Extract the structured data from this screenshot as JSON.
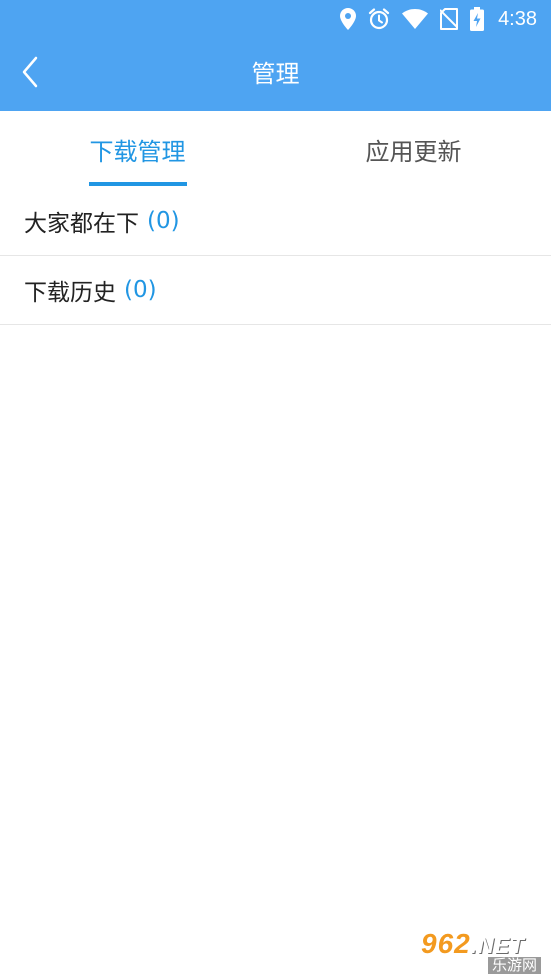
{
  "status_bar": {
    "time": "4:38",
    "icons": [
      "location-icon",
      "alarm-icon",
      "wifi-icon",
      "no-sim-icon",
      "battery-charging-icon"
    ]
  },
  "header": {
    "title": "管理",
    "back_icon": "chevron-left-icon"
  },
  "tabs": [
    {
      "label": "下载管理",
      "active": true
    },
    {
      "label": "应用更新",
      "active": false
    }
  ],
  "list": [
    {
      "label": "大家都在下",
      "count": "(0)"
    },
    {
      "label": "下载历史",
      "count": "(0)"
    }
  ],
  "watermark": {
    "top": "962",
    "top_suffix": ".NET",
    "bottom": "乐游网"
  },
  "colors": {
    "appbar": "#4ea4f2",
    "accent": "#2196e3",
    "divider": "#e6e6e6"
  }
}
